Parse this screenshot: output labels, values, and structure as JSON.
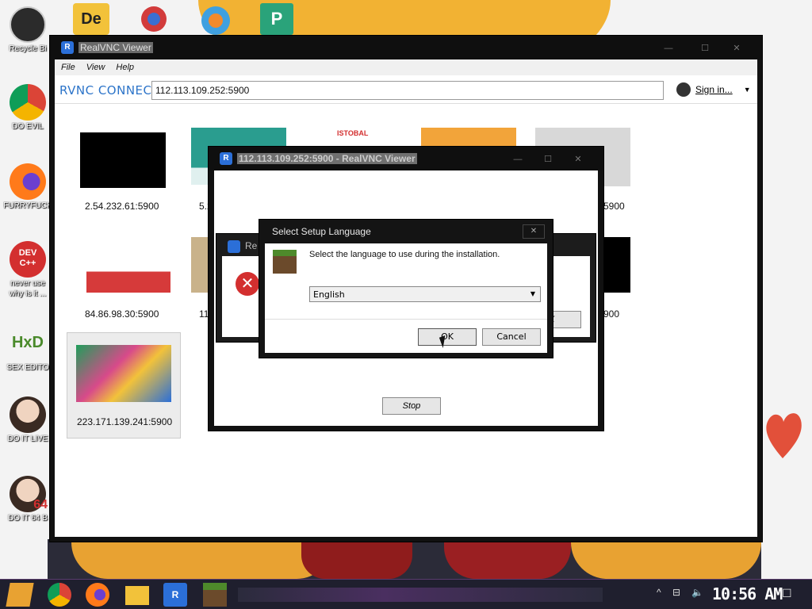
{
  "desktop": {
    "icons": [
      {
        "label": "Recycle Bi",
        "icon": "recycle-bin-icon"
      },
      {
        "label": "DO EVIL",
        "icon": "chrome-icon"
      },
      {
        "label": "FURRYFUCK",
        "icon": "firefox-icon"
      },
      {
        "label": "never use",
        "label2": "why is it ...",
        "icon": "dev-cpp-icon"
      },
      {
        "label": "SEX EDITO",
        "icon": "hxd-icon"
      },
      {
        "label": "DO IT LIVE",
        "icon": "portrait-icon"
      },
      {
        "label": "DO IT 64 B",
        "icon": "portrait-64-icon"
      }
    ],
    "dev_icon_text": "DEV\nC++",
    "hxd_icon_text": "HxD",
    "portrait64_badge": "64"
  },
  "vnc_main": {
    "title": "RealVNC Viewer",
    "menu": [
      "File",
      "View",
      "Help"
    ],
    "logo": "RVNC CONNECT",
    "address": "112.113.109.252:5900",
    "signin": "Sign in...",
    "controls": {
      "minimize": "—",
      "maximize": "☐",
      "close": "✕"
    },
    "thumbnails": [
      {
        "caption": "2.54.232.61:5900"
      },
      {
        "caption": "5.2"
      },
      {
        "caption": "ISTOBAL"
      },
      {
        "caption": ""
      },
      {
        "caption": "5900"
      },
      {
        "caption": "84.86.98.30:5900"
      },
      {
        "caption": "11"
      },
      {
        "caption": "900"
      },
      {
        "caption": "223.171.139.241:5900"
      }
    ]
  },
  "conn_window": {
    "title": "112.113.109.252:5900 - RealVNC Viewer",
    "stop_label": "Stop"
  },
  "error_dialog": {
    "title_partial": "Re",
    "button_partial": "K"
  },
  "lang_dialog": {
    "title": "Select Setup Language",
    "prompt": "Select the language to use during the installation.",
    "selected_language": "English",
    "ok_label": "OK",
    "cancel_label": "Cancel",
    "close_label": "✕"
  },
  "taskbar": {
    "clock": "10:56 AM",
    "tray": {
      "up": "^",
      "network": "⊟",
      "volume": "🔈",
      "notifications": "☐"
    }
  }
}
